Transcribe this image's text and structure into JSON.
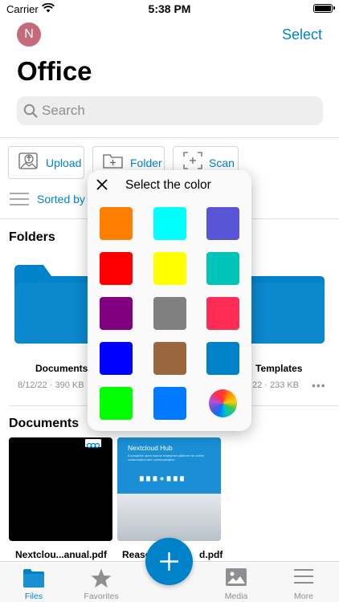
{
  "status_bar": {
    "carrier": "Carrier",
    "time": "5:38 PM"
  },
  "header": {
    "avatar_initial": "N",
    "select_label": "Select",
    "title": "Office"
  },
  "search": {
    "placeholder": "Search"
  },
  "actions": {
    "upload": "Upload",
    "folder": "Folder",
    "scan": "Scan"
  },
  "sort": {
    "label": "Sorted by"
  },
  "folders": {
    "title": "Folders",
    "items": [
      {
        "name": "Documents",
        "meta": "8/12/22 · 390 KB",
        "color": "#0082c9"
      },
      {
        "name": "Templates",
        "meta": "22 · 233 KB",
        "color": "#0082c9"
      }
    ]
  },
  "documents": {
    "title": "Documents",
    "items": [
      {
        "name": "Nextclou...anual.pdf"
      },
      {
        "name": "Reaso",
        "name_end": "d.pdf",
        "preview_title": "Nextcloud Hub",
        "preview_subtitle": "A complete open source enterprise platform for online collaboration and communication"
      }
    ]
  },
  "color_picker": {
    "title": "Select the color",
    "swatches": [
      {
        "name": "orange",
        "color": "#ff7f00"
      },
      {
        "name": "cyan",
        "color": "#00ffff"
      },
      {
        "name": "indigo",
        "color": "#5856d6"
      },
      {
        "name": "red",
        "color": "#ff0000"
      },
      {
        "name": "yellow",
        "color": "#ffff00"
      },
      {
        "name": "teal",
        "color": "#00c4b8"
      },
      {
        "name": "purple",
        "color": "#800080"
      },
      {
        "name": "gray",
        "color": "#808080"
      },
      {
        "name": "pink",
        "color": "#ff2d55"
      },
      {
        "name": "blue",
        "color": "#0000ff"
      },
      {
        "name": "brown",
        "color": "#99663d"
      },
      {
        "name": "nextcloud-blue",
        "color": "#0082c9"
      },
      {
        "name": "green",
        "color": "#00ff00"
      },
      {
        "name": "azure",
        "color": "#007aff"
      },
      {
        "name": "custom-color",
        "color": "conic-gradient"
      }
    ]
  },
  "tab_bar": {
    "items": [
      {
        "label": "Files",
        "icon": "folder-icon",
        "active": true
      },
      {
        "label": "Favorites",
        "icon": "star-icon",
        "active": false
      },
      {
        "label": "Media",
        "icon": "image-icon",
        "active": false
      },
      {
        "label": "More",
        "icon": "menu-icon",
        "active": false
      }
    ]
  },
  "colors": {
    "accent": "#0082c9",
    "inactive": "#8e8e93"
  }
}
